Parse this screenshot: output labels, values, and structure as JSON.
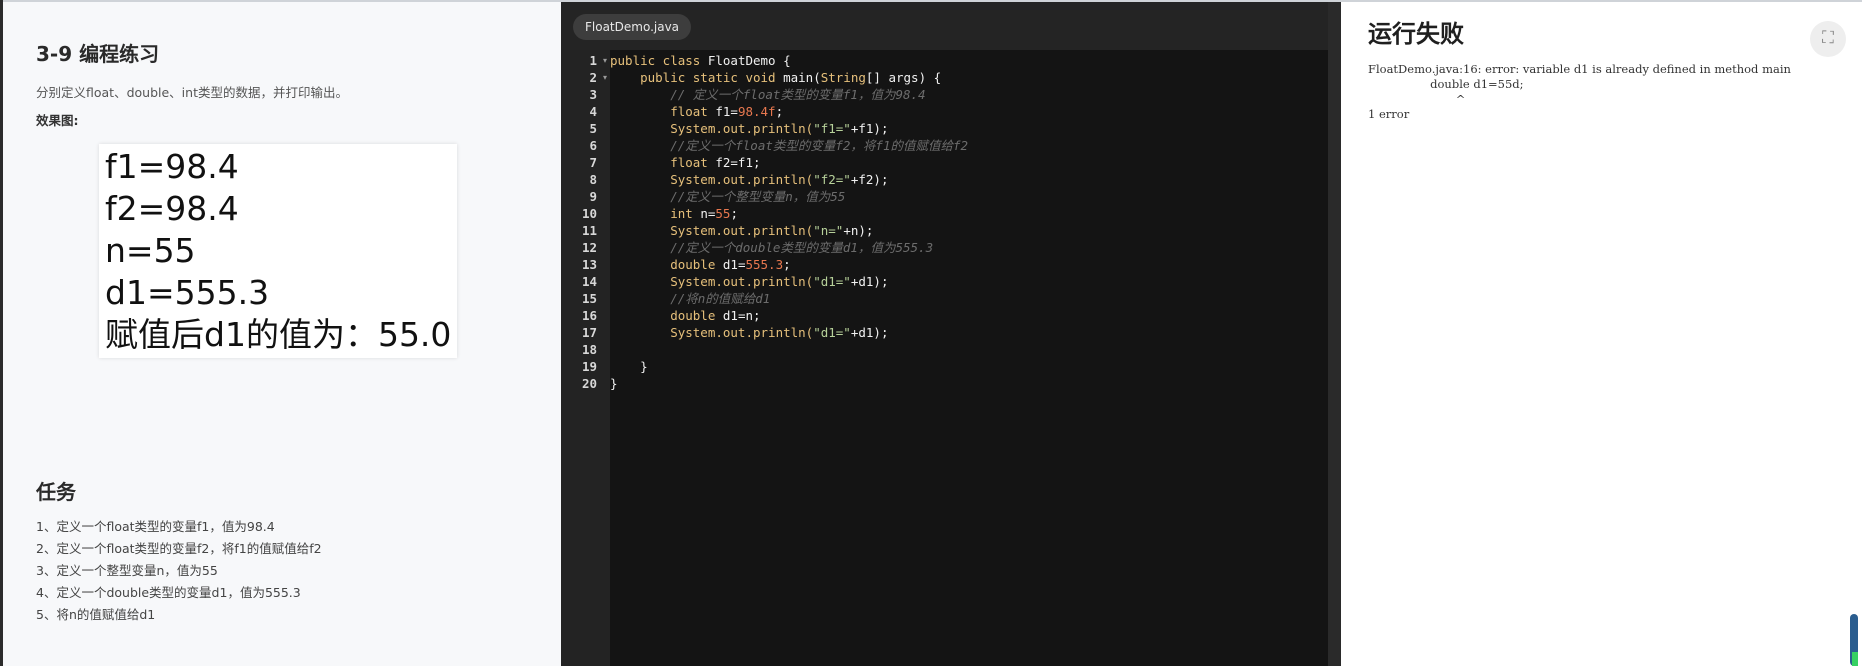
{
  "lesson": {
    "title": "3-9 编程练习",
    "description": "分别定义float、double、int类型的数据，并打印输出。",
    "effect_label": "效果图:",
    "effect_output": [
      "f1=98.4",
      "f2=98.4",
      "n=55",
      "d1=555.3",
      "赋值后d1的值为：55.0"
    ]
  },
  "tasks": {
    "title": "任务",
    "items": [
      "1、定义一个float类型的变量f1，值为98.4",
      "2、定义一个float类型的变量f2，将f1的值赋值给f2",
      "3、定义一个整型变量n，值为55",
      "4、定义一个double类型的变量d1，值为555.3",
      "5、将n的值赋值给d1"
    ]
  },
  "editor": {
    "tab": "FloatDemo.java",
    "line_numbers": [
      "1",
      "2",
      "3",
      "4",
      "5",
      "6",
      "7",
      "8",
      "9",
      "10",
      "11",
      "12",
      "13",
      "14",
      "15",
      "16",
      "17",
      "18",
      "19",
      "20"
    ],
    "fold_marker": "▾",
    "code": {
      "l1": [
        "public class ",
        "FloatDemo ",
        "{"
      ],
      "l2": [
        "    public static void ",
        "main(",
        "String",
        "[] args) {"
      ],
      "l3": [
        "        // 定义一个float类型的变量f1，值为98.4"
      ],
      "l4": [
        "        float ",
        "f1=",
        "98.4f",
        ";"
      ],
      "l5": [
        "        System.out.println(",
        "\"f1=\"",
        "+f1);"
      ],
      "l6": [
        "        //定义一个float类型的变量f2，将f1的值赋值给f2"
      ],
      "l7": [
        "        float ",
        "f2=f1;"
      ],
      "l8": [
        "        System.out.println(",
        "\"f2=\"",
        "+f2);"
      ],
      "l9": [
        "        //定义一个整型变量n，值为55"
      ],
      "l10": [
        "        int ",
        "n=",
        "55",
        ";"
      ],
      "l11": [
        "        System.out.println(",
        "\"n=\"",
        "+n);"
      ],
      "l12": [
        "        //定义一个double类型的变量d1，值为555.3"
      ],
      "l13": [
        "        double ",
        "d1=",
        "555.3",
        ";"
      ],
      "l14": [
        "        System.out.println(",
        "\"d1=\"",
        "+d1);"
      ],
      "l15": [
        "        //将n的值赋给d1"
      ],
      "l16": [
        "        double ",
        "d1=n;"
      ],
      "l17": [
        "        System.out.println(",
        "\"d1=\"",
        "+d1);"
      ],
      "l18": [
        ""
      ],
      "l19": [
        "    }"
      ],
      "l20": [
        "}"
      ]
    }
  },
  "output": {
    "title": "运行失败",
    "text": "FloatDemo.java:16: error: variable d1 is already defined in method main\n                 double d1=55d;\n                        ^\n1 error",
    "fullscreen_icon": "⛶"
  },
  "colors": {
    "editor_bg": "#141414",
    "gutter_bg": "#232323",
    "keyword": "#e6c07b",
    "comment": "#6c6c6c",
    "string": "#b7d19a",
    "number": "#e8784f"
  }
}
